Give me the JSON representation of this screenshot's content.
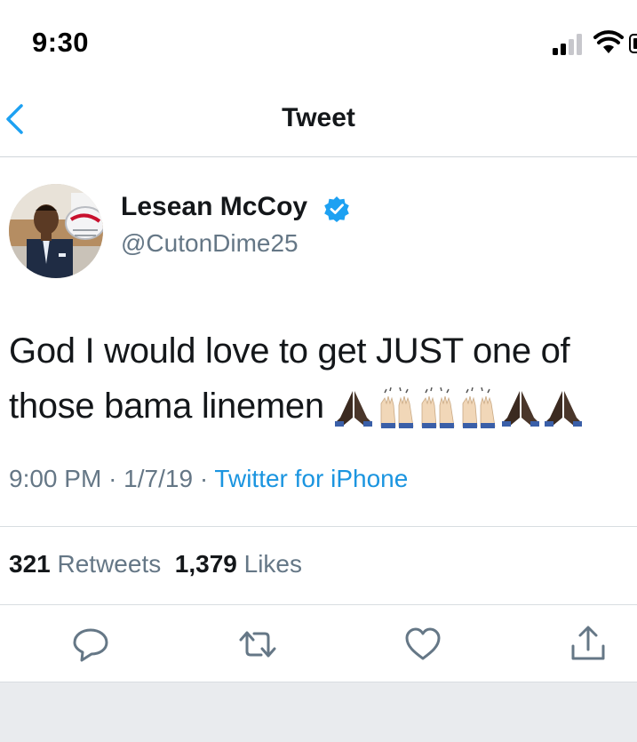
{
  "status_bar": {
    "time": "9:30"
  },
  "nav": {
    "title": "Tweet",
    "back_icon": "chevron-left-icon"
  },
  "tweet": {
    "author": {
      "display_name": "Lesean McCoy",
      "handle": "@CutonDime25",
      "verified": true
    },
    "text_line1": "God I would love to get JUST one of",
    "text_line2": "those bama linemen",
    "emojis": "🙏🏿🙌🏼🙌🏼🙌🏼🙏🏿🙏🏿",
    "time": "9:00 PM",
    "date": "1/7/19",
    "source": "Twitter for iPhone",
    "separator": "·"
  },
  "stats": {
    "retweets_count": "321",
    "retweets_label": "Retweets",
    "likes_count": "1,379",
    "likes_label": "Likes"
  },
  "actions": [
    "reply-icon",
    "retweet-icon",
    "like-icon",
    "share-icon"
  ],
  "colors": {
    "link": "#1b95e0",
    "secondary": "#657786",
    "text": "#14171a",
    "verified": "#1da1f2"
  }
}
